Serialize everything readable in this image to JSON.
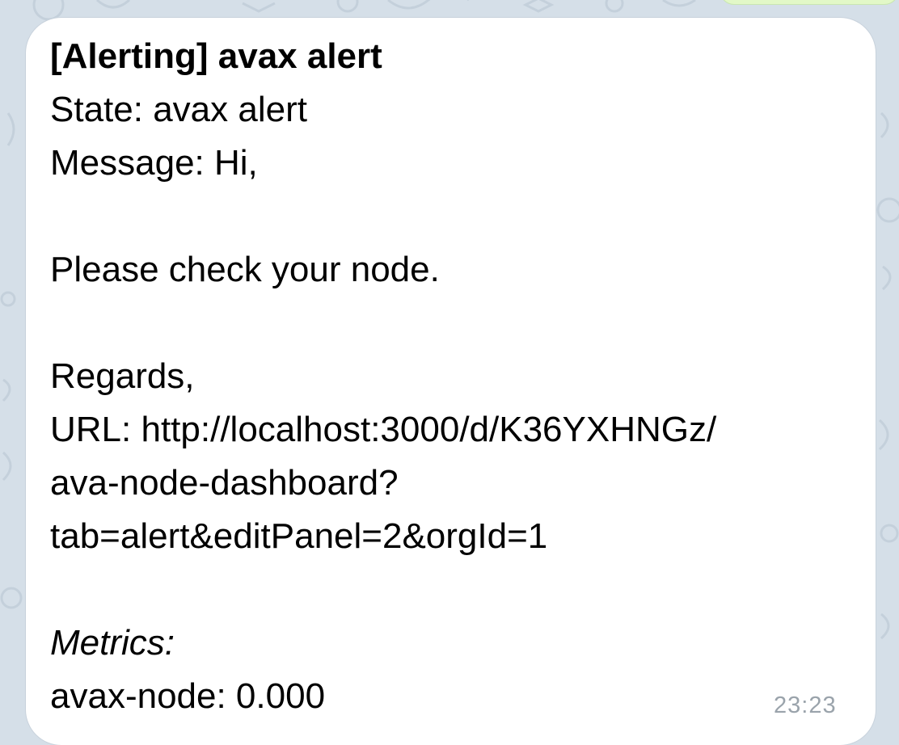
{
  "message": {
    "title": "[Alerting] avax alert",
    "state": "State: avax alert",
    "message": "Message: Hi,",
    "check": "Please check your node.",
    "regards": "Regards,",
    "url_prefix": "URL: ",
    "url_line1": "http://localhost:3000/d/K36YXHNGz/",
    "url_line2": "ava-node-dashboard?",
    "url_line3": "tab=alert&editPanel=2&orgId=1",
    "metrics_label": "Metrics:",
    "metric_value": "avax-node: 0.000",
    "time": "23:23"
  },
  "colors": {
    "background": "#d5dfe8",
    "bubble": "#ffffff",
    "time_text": "#9aa3ab"
  }
}
